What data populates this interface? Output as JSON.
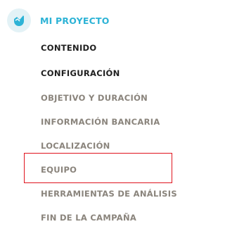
{
  "project": {
    "title": "MI PROYECTO",
    "icon": "kickstart-bird-icon",
    "accent_color": "#2db3d6"
  },
  "nav": {
    "main_items": [
      {
        "label": "CONTENIDO"
      },
      {
        "label": "CONFIGURACIÓN"
      }
    ],
    "sub_items": [
      {
        "label": "OBJETIVO Y DURACIÓN"
      },
      {
        "label": "INFORMACIÓN BANCARIA"
      },
      {
        "label": "LOCALIZACIÓN"
      },
      {
        "label": "EQUIPO"
      },
      {
        "label": "HERRAMIENTAS DE ANÁLISIS"
      },
      {
        "label": "FIN DE LA CAMPAÑA"
      }
    ]
  },
  "highlight": {
    "target": "EQUIPO",
    "color": "#e0141e"
  }
}
